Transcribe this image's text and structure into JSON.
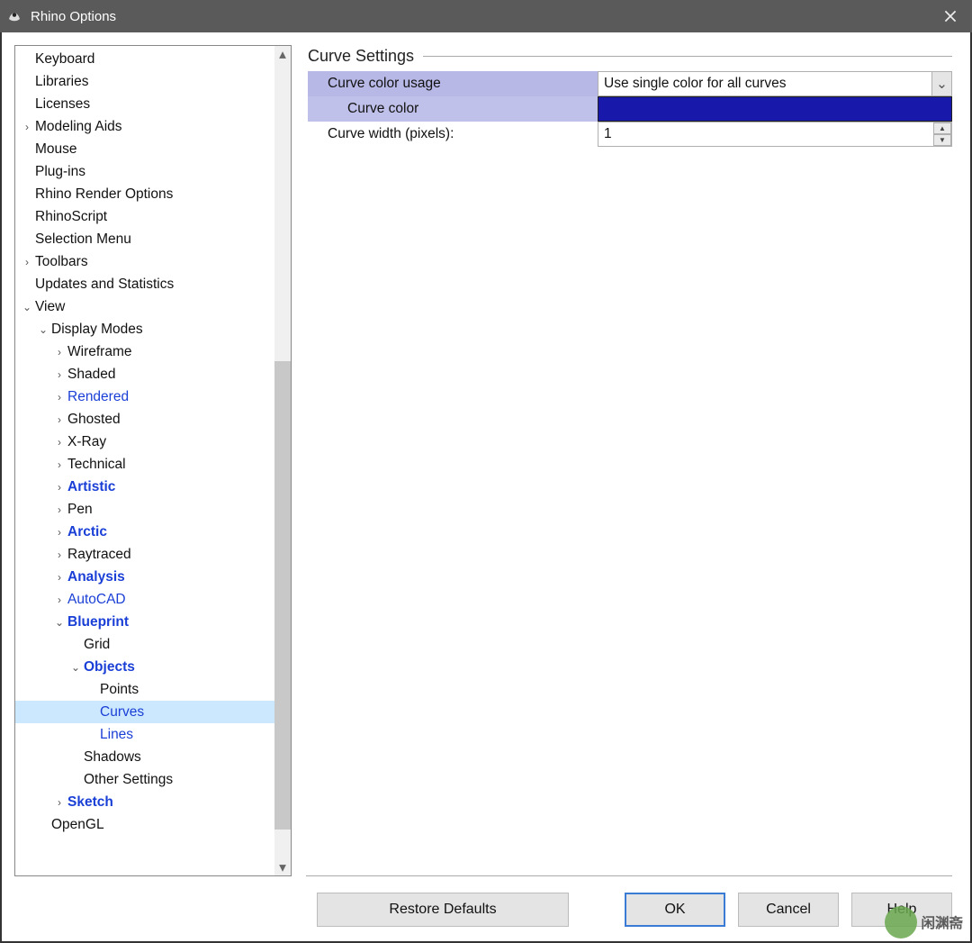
{
  "window": {
    "title": "Rhino Options"
  },
  "tree": {
    "items": [
      {
        "indent": 1,
        "label": "Keyboard",
        "expander": "",
        "link": false,
        "bold": false,
        "selected": false
      },
      {
        "indent": 1,
        "label": "Libraries",
        "expander": "",
        "link": false,
        "bold": false,
        "selected": false
      },
      {
        "indent": 1,
        "label": "Licenses",
        "expander": "",
        "link": false,
        "bold": false,
        "selected": false
      },
      {
        "indent": 1,
        "label": "Modeling Aids",
        "expander": ">",
        "link": false,
        "bold": false,
        "selected": false
      },
      {
        "indent": 1,
        "label": "Mouse",
        "expander": "",
        "link": false,
        "bold": false,
        "selected": false
      },
      {
        "indent": 1,
        "label": "Plug-ins",
        "expander": "",
        "link": false,
        "bold": false,
        "selected": false
      },
      {
        "indent": 1,
        "label": "Rhino Render Options",
        "expander": "",
        "link": false,
        "bold": false,
        "selected": false
      },
      {
        "indent": 1,
        "label": "RhinoScript",
        "expander": "",
        "link": false,
        "bold": false,
        "selected": false
      },
      {
        "indent": 1,
        "label": "Selection Menu",
        "expander": "",
        "link": false,
        "bold": false,
        "selected": false
      },
      {
        "indent": 1,
        "label": "Toolbars",
        "expander": ">",
        "link": false,
        "bold": false,
        "selected": false
      },
      {
        "indent": 1,
        "label": "Updates and Statistics",
        "expander": "",
        "link": false,
        "bold": false,
        "selected": false
      },
      {
        "indent": 1,
        "label": "View",
        "expander": "v",
        "link": false,
        "bold": false,
        "selected": false
      },
      {
        "indent": 2,
        "label": "Display Modes",
        "expander": "v",
        "link": false,
        "bold": false,
        "selected": false
      },
      {
        "indent": 3,
        "label": "Wireframe",
        "expander": ">",
        "link": false,
        "bold": false,
        "selected": false
      },
      {
        "indent": 3,
        "label": "Shaded",
        "expander": ">",
        "link": false,
        "bold": false,
        "selected": false
      },
      {
        "indent": 3,
        "label": "Rendered",
        "expander": ">",
        "link": true,
        "bold": false,
        "selected": false
      },
      {
        "indent": 3,
        "label": "Ghosted",
        "expander": ">",
        "link": false,
        "bold": false,
        "selected": false
      },
      {
        "indent": 3,
        "label": "X-Ray",
        "expander": ">",
        "link": false,
        "bold": false,
        "selected": false
      },
      {
        "indent": 3,
        "label": "Technical",
        "expander": ">",
        "link": false,
        "bold": false,
        "selected": false
      },
      {
        "indent": 3,
        "label": "Artistic",
        "expander": ">",
        "link": true,
        "bold": true,
        "selected": false
      },
      {
        "indent": 3,
        "label": "Pen",
        "expander": ">",
        "link": false,
        "bold": false,
        "selected": false
      },
      {
        "indent": 3,
        "label": "Arctic",
        "expander": ">",
        "link": true,
        "bold": true,
        "selected": false
      },
      {
        "indent": 3,
        "label": "Raytraced",
        "expander": ">",
        "link": false,
        "bold": false,
        "selected": false
      },
      {
        "indent": 3,
        "label": "Analysis",
        "expander": ">",
        "link": true,
        "bold": true,
        "selected": false
      },
      {
        "indent": 3,
        "label": "AutoCAD",
        "expander": ">",
        "link": true,
        "bold": false,
        "selected": false
      },
      {
        "indent": 3,
        "label": "Blueprint",
        "expander": "v",
        "link": true,
        "bold": true,
        "selected": false
      },
      {
        "indent": 4,
        "label": "Grid",
        "expander": "",
        "link": false,
        "bold": false,
        "selected": false
      },
      {
        "indent": 4,
        "label": "Objects",
        "expander": "v",
        "link": true,
        "bold": true,
        "selected": false
      },
      {
        "indent": 5,
        "label": "Points",
        "expander": "",
        "link": false,
        "bold": false,
        "selected": false
      },
      {
        "indent": 5,
        "label": "Curves",
        "expander": "",
        "link": true,
        "bold": false,
        "selected": true
      },
      {
        "indent": 5,
        "label": "Lines",
        "expander": "",
        "link": true,
        "bold": false,
        "selected": false
      },
      {
        "indent": 4,
        "label": "Shadows",
        "expander": "",
        "link": false,
        "bold": false,
        "selected": false
      },
      {
        "indent": 4,
        "label": "Other Settings",
        "expander": "",
        "link": false,
        "bold": false,
        "selected": false
      },
      {
        "indent": 3,
        "label": "Sketch",
        "expander": ">",
        "link": true,
        "bold": true,
        "selected": false
      },
      {
        "indent": 2,
        "label": "OpenGL",
        "expander": "",
        "link": false,
        "bold": false,
        "selected": false
      }
    ]
  },
  "settings": {
    "header": "Curve Settings",
    "rows": {
      "color_usage_label": "Curve color usage",
      "color_usage_value": "Use single color for all curves",
      "curve_color_label": "Curve color",
      "curve_color_hex": "#1818aa",
      "curve_width_label": "Curve width (pixels):",
      "curve_width_value": "1"
    }
  },
  "buttons": {
    "restore": "Restore Defaults",
    "ok": "OK",
    "cancel": "Cancel",
    "help": "Help"
  },
  "watermark": "闲渊斋"
}
